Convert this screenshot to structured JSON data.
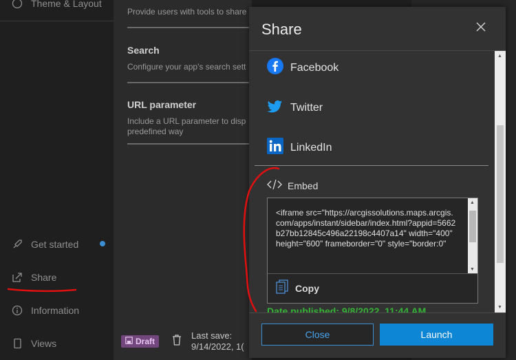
{
  "sidebar": {
    "top_item": "Theme & Layout",
    "items": [
      {
        "label": "Get started",
        "icon": "rocket-icon"
      },
      {
        "label": "Share",
        "icon": "share-icon"
      },
      {
        "label": "Information",
        "icon": "info-icon"
      },
      {
        "label": "Views",
        "icon": "tablet-icon"
      }
    ]
  },
  "settings": {
    "sections": [
      {
        "title": "",
        "description": "Provide users with tools to share"
      },
      {
        "title": "Search",
        "description": "Configure your app's search sett"
      },
      {
        "title": "URL parameter",
        "description": "Include a URL parameter to disp",
        "description2": "predefined way"
      }
    ]
  },
  "footer": {
    "draft_label": "Draft",
    "last_save_label": "Last save:",
    "last_save_value": "9/14/2022, 1("
  },
  "modal": {
    "title": "Share",
    "social": [
      {
        "label": "Facebook",
        "icon": "facebook-icon",
        "color": "#1877f2"
      },
      {
        "label": "Twitter",
        "icon": "twitter-icon",
        "color": "#1d9bf0"
      },
      {
        "label": "LinkedIn",
        "icon": "linkedin-icon",
        "color": "#0a66c2"
      }
    ],
    "embed_label": "Embed",
    "embed_code": "<iframe src=\"https://arcgissolutions.maps.arcgis.com/apps/instant/sidebar/index.html?appid=5662b27bb12845c496a22198c4407a14\" width=\"400\" height=\"600\" frameborder=\"0\" style=\"border:0\"",
    "copy_label": "Copy",
    "published": "Date published: 9/8/2022, 11:44 AM",
    "close_label": "Close",
    "launch_label": "Launch"
  },
  "colors": {
    "accent": "#0e86d6",
    "published": "#35b535",
    "annotation": "#e01010"
  }
}
